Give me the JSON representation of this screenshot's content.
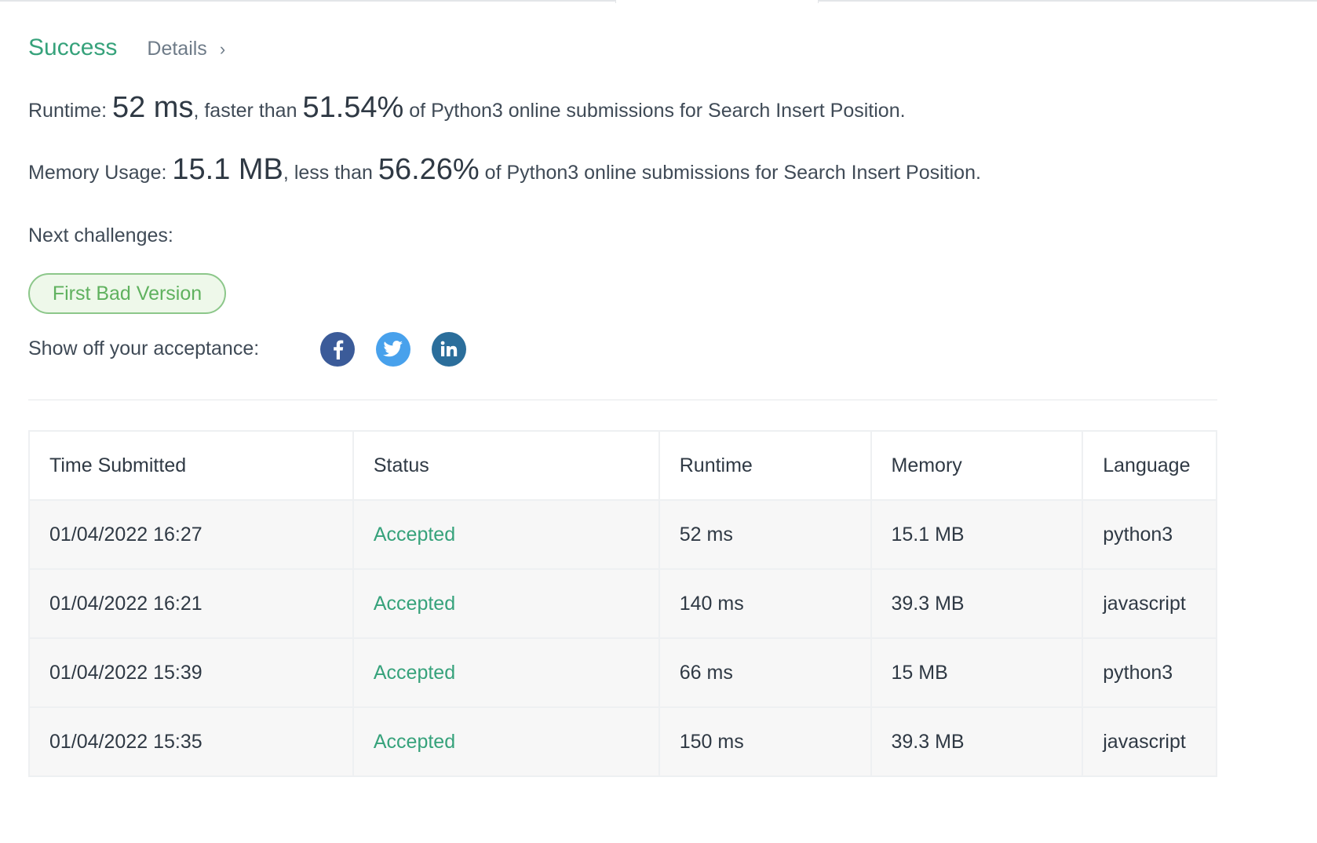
{
  "result": {
    "status_title": "Success",
    "details_label": "Details",
    "details_chevron": "›"
  },
  "runtime_line": {
    "label": "Runtime: ",
    "value": "52 ms",
    "comparison": ", faster than ",
    "percent": "51.54%",
    "suffix": " of Python3 online submissions for Search Insert Position."
  },
  "memory_line": {
    "label": "Memory Usage: ",
    "value": "15.1 MB",
    "comparison": ", less than ",
    "percent": "56.26%",
    "suffix": " of Python3 online submissions for Search Insert Position."
  },
  "next": {
    "label": "Next challenges:",
    "challenges": [
      "First Bad Version"
    ]
  },
  "share": {
    "label": "Show off your acceptance:",
    "icons": [
      "facebook-icon",
      "twitter-icon",
      "linkedin-icon"
    ],
    "colors": {
      "facebook": "#3b5b99",
      "twitter": "#48a1ec",
      "linkedin": "#2b6e9b"
    }
  },
  "table": {
    "headers": [
      "Time Submitted",
      "Status",
      "Runtime",
      "Memory",
      "Language"
    ],
    "rows": [
      [
        "01/04/2022 16:27",
        "Accepted",
        "52 ms",
        "15.1 MB",
        "python3"
      ],
      [
        "01/04/2022 16:21",
        "Accepted",
        "140 ms",
        "39.3 MB",
        "javascript"
      ],
      [
        "01/04/2022 15:39",
        "Accepted",
        "66 ms",
        "15 MB",
        "python3"
      ],
      [
        "01/04/2022 15:35",
        "Accepted",
        "150 ms",
        "39.3 MB",
        "javascript"
      ]
    ]
  },
  "colors": {
    "accent": "#36a27b",
    "challenge_pill": "#5fb15e"
  }
}
